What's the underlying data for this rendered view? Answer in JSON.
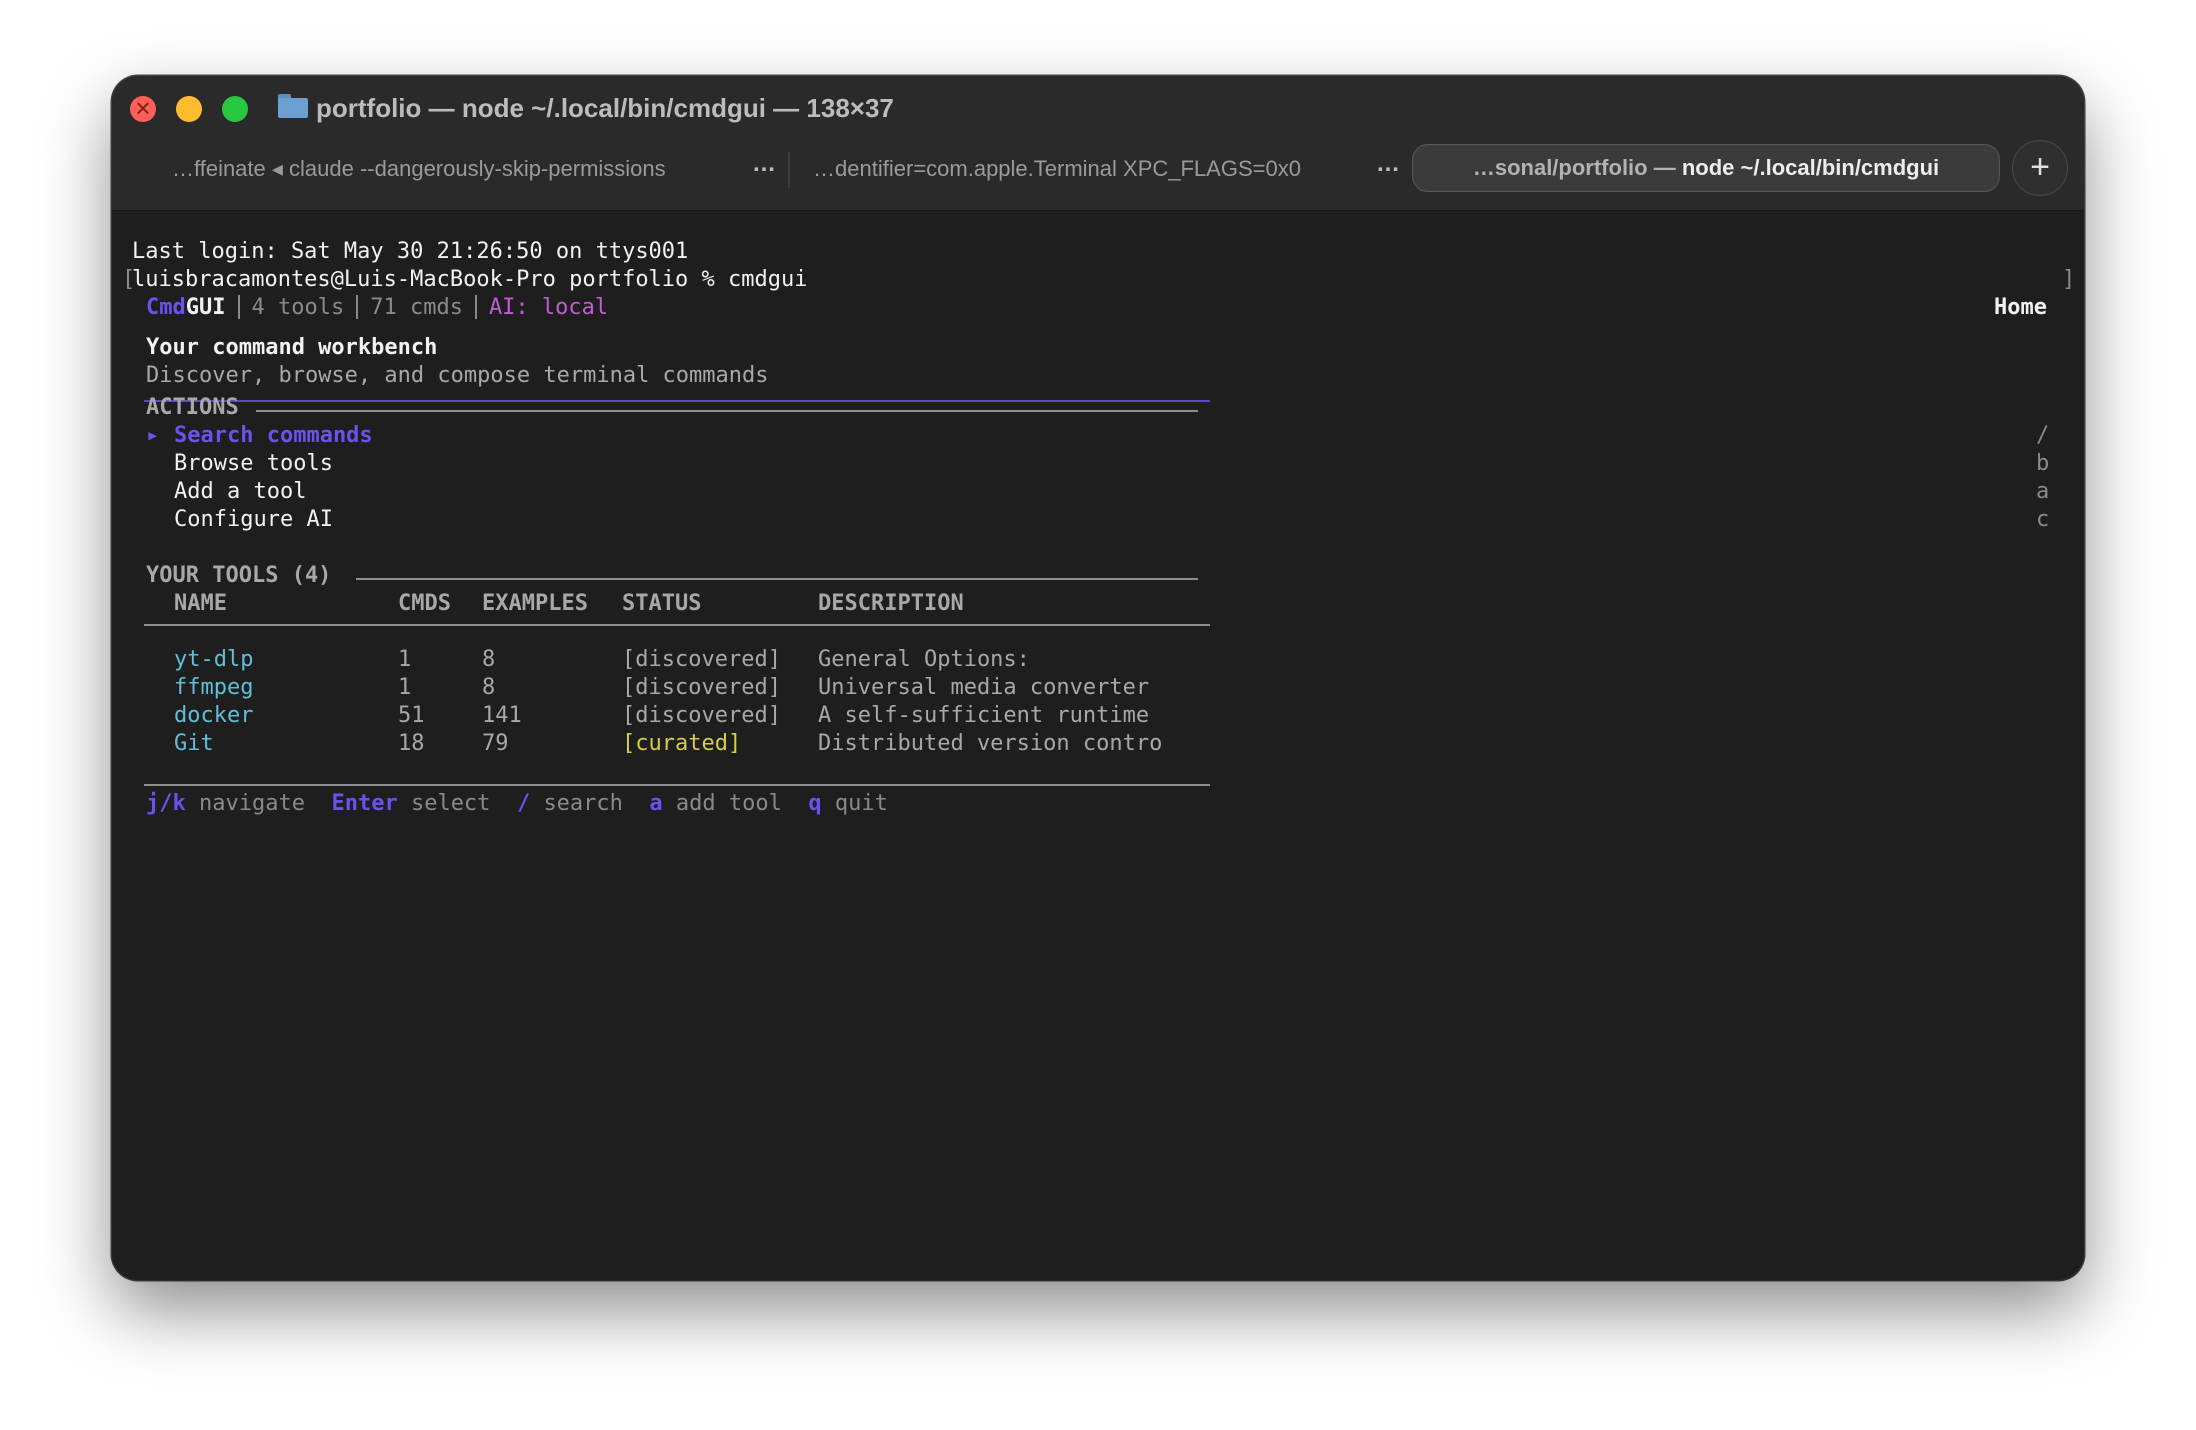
{
  "window": {
    "title": "portfolio — node ~/.local/bin/cmdgui — 138×37",
    "tabs": [
      {
        "label": "…ffeinate ◂ claude --dangerously-skip-permissions",
        "active": false
      },
      {
        "label": "…dentifier=com.apple.Terminal XPC_FLAGS=0x0",
        "active": false
      },
      {
        "label_dim": "…sonal/portfolio — ",
        "label_bright": "node ~/.local/bin/cmdgui",
        "active": true
      }
    ],
    "more_label": "…",
    "new_tab_label": "+"
  },
  "terminal": {
    "last_login": "Last login: Sat May 30 21:26:50 on ttys001",
    "prompt_bracket": "[",
    "prompt": "luisbracamontes@Luis-MacBook-Pro portfolio % cmdgui",
    "right_bracket": "]"
  },
  "app": {
    "brand_cmd": "Cmd",
    "brand_gui": "GUI",
    "tools_count": "4 tools",
    "cmds_count": "71 cmds",
    "ai_status": "AI: local",
    "page": "Home",
    "headline": "Your command workbench",
    "subtitle": "Discover, browse, and compose terminal commands",
    "actions_heading": "ACTIONS",
    "selected_marker": "▸",
    "actions": [
      {
        "label": "Search commands",
        "key": "/",
        "selected": true
      },
      {
        "label": "Browse tools",
        "key": "b",
        "selected": false
      },
      {
        "label": "Add a tool",
        "key": "a",
        "selected": false
      },
      {
        "label": "Configure AI",
        "key": "c",
        "selected": false
      }
    ],
    "tools_heading": "YOUR TOOLS (4)",
    "columns": [
      "NAME",
      "CMDS",
      "EXAMPLES",
      "STATUS",
      "DESCRIPTION"
    ],
    "tools": [
      {
        "name": "yt-dlp",
        "cmds": "1",
        "examples": "8",
        "status": "[discovered]",
        "description": "General Options:"
      },
      {
        "name": "ffmpeg",
        "cmds": "1",
        "examples": "8",
        "status": "[discovered]",
        "description": "Universal media converter"
      },
      {
        "name": "docker",
        "cmds": "51",
        "examples": "141",
        "status": "[discovered]",
        "description": "A self-sufficient runtime"
      },
      {
        "name": "Git",
        "cmds": "18",
        "examples": "79",
        "status": "[curated]",
        "description": "Distributed version contro"
      }
    ],
    "shortcuts": [
      {
        "key": "j/k",
        "label": "navigate"
      },
      {
        "key": "Enter",
        "label": "select"
      },
      {
        "key": "/",
        "label": "search"
      },
      {
        "key": "a",
        "label": "add tool"
      },
      {
        "key": "q",
        "label": "quit"
      }
    ]
  },
  "colors": {
    "accent_purple": "#6e4ff0",
    "tool_cyan": "#5fbfd6",
    "curated_yellow": "#d6cd47",
    "ai_magenta": "#c35bd6",
    "terminal_bg": "#1e1e1e"
  }
}
